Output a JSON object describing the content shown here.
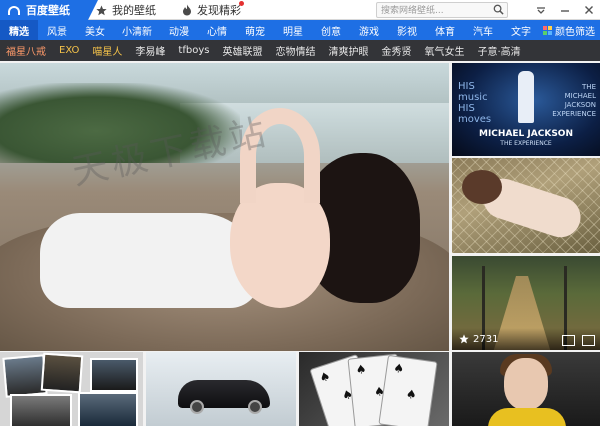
{
  "titlebar": {
    "brand": "百度壁纸",
    "tabs": [
      {
        "label": "我的壁纸",
        "icon": "star-icon"
      },
      {
        "label": "发现精彩",
        "icon": "flame-icon"
      }
    ],
    "search_placeholder": "搜索网络壁纸...",
    "window_controls": [
      "menu-icon",
      "minimize-icon",
      "close-icon"
    ]
  },
  "categories": [
    "精选",
    "风景",
    "美女",
    "小清新",
    "动漫",
    "心情",
    "萌宠",
    "明星",
    "创意",
    "游戏",
    "影视",
    "体育",
    "汽车",
    "文字",
    "颜色筛选"
  ],
  "active_category": "精选",
  "tags": [
    {
      "label": "福星八戒",
      "color": "#ff9a6a"
    },
    {
      "label": "EXO",
      "color": "#f4c24a"
    },
    {
      "label": "喵星人",
      "color": "#f4c24a"
    },
    {
      "label": "李易峰",
      "color": "#e8e8e8"
    },
    {
      "label": "tfboys",
      "color": "#e8e8e8"
    },
    {
      "label": "英雄联盟",
      "color": "#e8e8e8"
    },
    {
      "label": "恋物情结",
      "color": "#e8e8e8"
    },
    {
      "label": "清爽护眼",
      "color": "#e8e8e8"
    },
    {
      "label": "金秀贤",
      "color": "#e8e8e8"
    },
    {
      "label": "氧气女生",
      "color": "#e8e8e8"
    },
    {
      "label": "子意·高清",
      "color": "#e8e8e8"
    }
  ],
  "hero": {
    "watermark": "天极下载站"
  },
  "mj_tile": {
    "left_text": [
      "HIS",
      "music",
      "HIS",
      "moves"
    ],
    "right_text": [
      "THE",
      "MICHAEL",
      "JACKSON",
      "EXPERIENCE"
    ],
    "name": "MICHAEL JACKSON",
    "sub": "THE EXPERIENCE"
  },
  "forest_tile": {
    "favorites": "2731"
  },
  "colors": {
    "brand_blue": "#1e6fe4",
    "active_blue": "#1559c5",
    "tagbar_bg": "#333438"
  }
}
